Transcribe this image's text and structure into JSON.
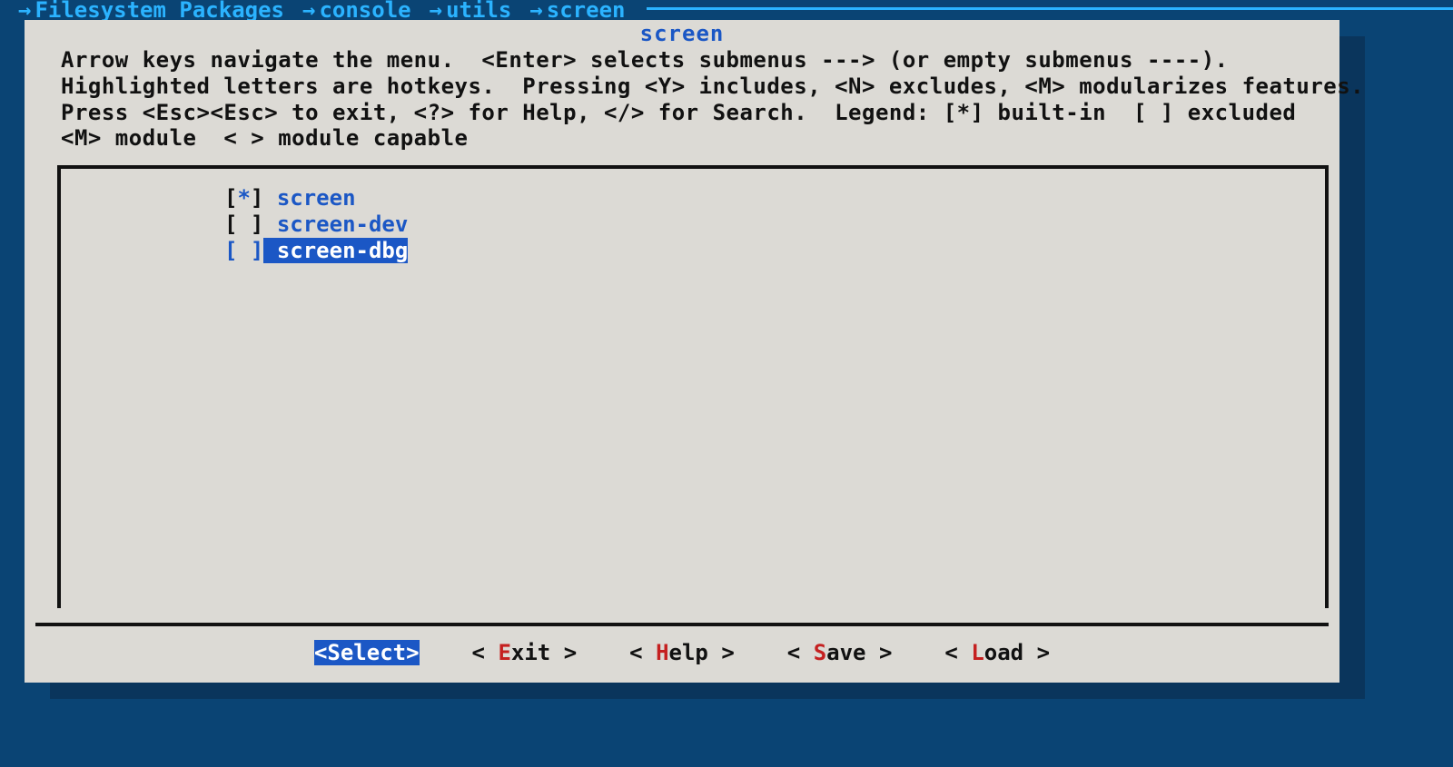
{
  "breadcrumb": {
    "items": [
      {
        "label": "Filesystem Packages",
        "has_arrow": true
      },
      {
        "label": "console",
        "has_arrow": true
      },
      {
        "label": "utils",
        "has_arrow": true
      },
      {
        "label": "screen",
        "has_arrow": true
      }
    ]
  },
  "dialog": {
    "title": "screen",
    "help_line1": "Arrow keys navigate the menu.  <Enter> selects submenus ---> (or empty submenus ----).",
    "help_line2": "Highlighted letters are hotkeys.  Pressing <Y> includes, <N> excludes, <M> modularizes features.",
    "help_line3": "Press <Esc><Esc> to exit, <?> for Help, </> for Search.  Legend: [*] built-in  [ ] excluded",
    "help_line4": "<M> module  < > module capable"
  },
  "packages": [
    {
      "mark": "*",
      "hotkey": "s",
      "rest": "creen",
      "selected": false
    },
    {
      "mark": " ",
      "hotkey": "s",
      "rest": "creen-dev",
      "selected": false
    },
    {
      "mark": " ",
      "hotkey": "s",
      "rest": "creen-dbg",
      "selected": true
    }
  ],
  "buttons": [
    {
      "pre": "<",
      "hotkey": "S",
      "rest": "elect",
      "post": ">",
      "active": true
    },
    {
      "pre": "< ",
      "hotkey": "E",
      "rest": "xit",
      "post": " >",
      "active": false
    },
    {
      "pre": "< ",
      "hotkey": "H",
      "rest": "elp",
      "post": " >",
      "active": false
    },
    {
      "pre": "< ",
      "hotkey": "S",
      "rest": "ave",
      "post": " >",
      "active": false
    },
    {
      "pre": "< ",
      "hotkey": "L",
      "rest": "oad",
      "post": " >",
      "active": false
    }
  ]
}
